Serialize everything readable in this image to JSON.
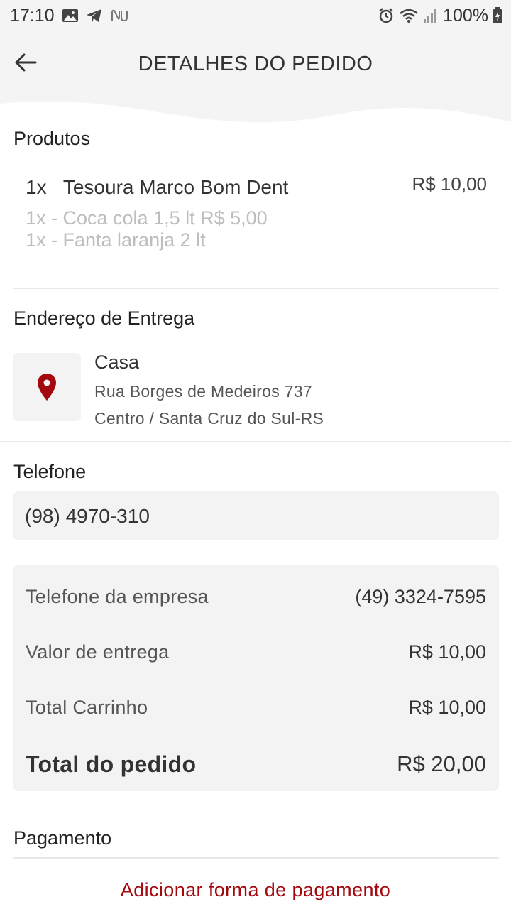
{
  "status_bar": {
    "time": "17:10",
    "battery": "100%",
    "left_icons": [
      "image-icon",
      "telegram-icon",
      "nubank-icon"
    ],
    "right_icons": [
      "alarm-icon",
      "wifi-icon",
      "signal-icon",
      "battery-charging-icon"
    ]
  },
  "header": {
    "back_icon": "arrow-left-icon",
    "title": "DETALHES DO PEDIDO"
  },
  "products": {
    "title": "Produtos",
    "items": [
      {
        "qty": "1x",
        "name": "Tesoura Marco Bom Dent",
        "price": "R$ 10,00",
        "addons": [
          "1x - Coca cola 1,5 lt R$ 5,00",
          "1x - Fanta laranja 2 lt"
        ]
      }
    ]
  },
  "address": {
    "title": "Endereço de Entrega",
    "icon": "map-pin-icon",
    "name": "Casa",
    "line1": "Rua Borges de Medeiros 737",
    "line2": "Centro / Santa Cruz do Sul-RS"
  },
  "phone": {
    "label": "Telefone",
    "value": "(98) 4970-310"
  },
  "summary": {
    "company_phone_label": "Telefone da empresa",
    "company_phone_value": "(49) 3324-7595",
    "delivery_label": "Valor de entrega",
    "delivery_value": "R$ 10,00",
    "cart_label": "Total Carrinho",
    "cart_value": "R$ 10,00",
    "total_label": "Total do pedido",
    "total_value": "R$ 20,00"
  },
  "payment": {
    "title": "Pagamento",
    "add_label": "Adicionar forma de pagamento"
  },
  "colors": {
    "accent": "#a30a10",
    "card_bg": "#f3f3f3",
    "header_bg": "#f4f4f4"
  }
}
